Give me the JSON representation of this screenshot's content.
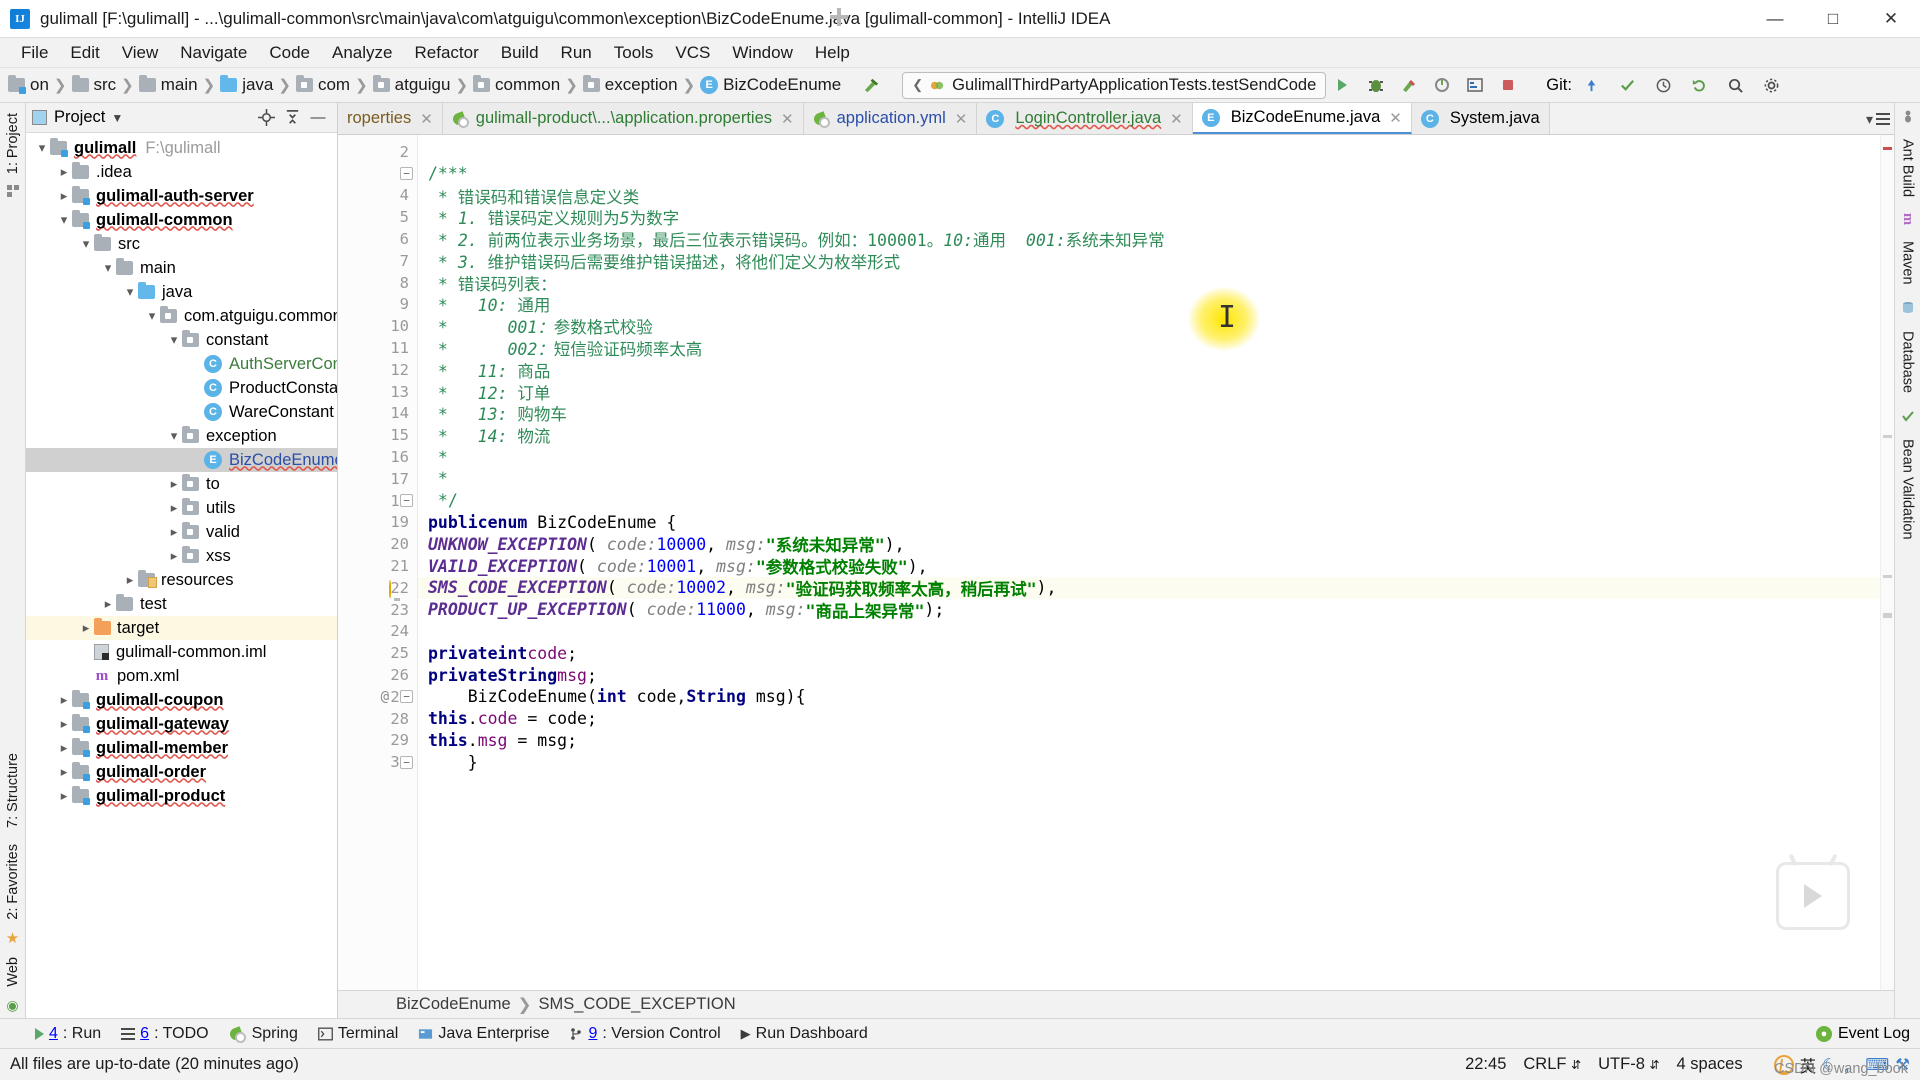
{
  "window": {
    "title": "gulimall [F:\\gulimall] - ...\\gulimall-common\\src\\main\\java\\com\\atguigu\\common\\exception\\BizCodeEnume.java [gulimall-common] - IntelliJ IDEA",
    "logo_text": "IJ",
    "minimize": "—",
    "maximize": "□",
    "close": "✕"
  },
  "menu": [
    {
      "label": "File"
    },
    {
      "label": "Edit"
    },
    {
      "label": "View"
    },
    {
      "label": "Navigate"
    },
    {
      "label": "Code"
    },
    {
      "label": "Analyze"
    },
    {
      "label": "Refactor"
    },
    {
      "label": "Build"
    },
    {
      "label": "Run"
    },
    {
      "label": "Tools"
    },
    {
      "label": "VCS"
    },
    {
      "label": "Window"
    },
    {
      "label": "Help"
    }
  ],
  "navbar": {
    "crumbs": [
      {
        "label": "on",
        "icon": "module-icon"
      },
      {
        "label": "src",
        "icon": "folder-icon"
      },
      {
        "label": "main",
        "icon": "folder-icon"
      },
      {
        "label": "java",
        "icon": "source-folder-icon"
      },
      {
        "label": "com",
        "icon": "package-icon"
      },
      {
        "label": "atguigu",
        "icon": "package-icon"
      },
      {
        "label": "common",
        "icon": "package-icon"
      },
      {
        "label": "exception",
        "icon": "package-icon"
      },
      {
        "label": "BizCodeEnume",
        "icon": "enum-icon"
      }
    ],
    "run_config": "GulimallThirdPartyApplicationTests.testSendCode",
    "git_label": "Git:"
  },
  "project_panel": {
    "title": "Project",
    "tree": [
      {
        "depth": 0,
        "twist": "v",
        "label": "gulimall",
        "hint": "F:\\gulimall",
        "icon": "module-icon",
        "style": "bold",
        "state": "normal"
      },
      {
        "depth": 1,
        "twist": ">",
        "label": ".idea",
        "icon": "folder-icon",
        "style": "muted",
        "state": "normal"
      },
      {
        "depth": 1,
        "twist": ">",
        "label": "gulimall-auth-server",
        "icon": "module-icon",
        "style": "bold",
        "state": "normal"
      },
      {
        "depth": 1,
        "twist": "v",
        "label": "gulimall-common",
        "icon": "module-icon",
        "style": "bold",
        "state": "normal"
      },
      {
        "depth": 2,
        "twist": "v",
        "label": "src",
        "icon": "folder-icon",
        "style": "normal",
        "state": "normal"
      },
      {
        "depth": 3,
        "twist": "v",
        "label": "main",
        "icon": "folder-icon",
        "style": "normal",
        "state": "normal"
      },
      {
        "depth": 4,
        "twist": "v",
        "label": "java",
        "icon": "source-folder-icon",
        "style": "normal",
        "state": "normal"
      },
      {
        "depth": 5,
        "twist": "v",
        "label": "com.atguigu.common",
        "icon": "package-icon",
        "style": "normal",
        "state": "normal"
      },
      {
        "depth": 6,
        "twist": "v",
        "label": "constant",
        "icon": "package-icon",
        "style": "normal",
        "state": "normal"
      },
      {
        "depth": 7,
        "twist": "",
        "label": "AuthServerConst",
        "icon": "class-icon",
        "style": "green",
        "state": "normal"
      },
      {
        "depth": 7,
        "twist": "",
        "label": "ProductConstant",
        "icon": "class-icon",
        "style": "normal",
        "state": "normal"
      },
      {
        "depth": 7,
        "twist": "",
        "label": "WareConstant",
        "icon": "class-icon",
        "style": "normal",
        "state": "normal"
      },
      {
        "depth": 6,
        "twist": "v",
        "label": "exception",
        "icon": "package-icon",
        "style": "normal",
        "state": "normal"
      },
      {
        "depth": 7,
        "twist": "",
        "label": "BizCodeEnume",
        "icon": "enum-icon",
        "style": "blue",
        "state": "selected"
      },
      {
        "depth": 6,
        "twist": ">",
        "label": "to",
        "icon": "package-icon",
        "style": "normal",
        "state": "normal"
      },
      {
        "depth": 6,
        "twist": ">",
        "label": "utils",
        "icon": "package-icon",
        "style": "normal",
        "state": "normal"
      },
      {
        "depth": 6,
        "twist": ">",
        "label": "valid",
        "icon": "package-icon",
        "style": "normal",
        "state": "normal"
      },
      {
        "depth": 6,
        "twist": ">",
        "label": "xss",
        "icon": "package-icon",
        "style": "normal",
        "state": "normal"
      },
      {
        "depth": 4,
        "twist": ">",
        "label": "resources",
        "icon": "resources-folder-icon",
        "style": "normal",
        "state": "normal"
      },
      {
        "depth": 3,
        "twist": ">",
        "label": "test",
        "icon": "folder-icon",
        "style": "normal",
        "state": "normal"
      },
      {
        "depth": 2,
        "twist": ">",
        "label": "target",
        "icon": "target-folder-icon",
        "style": "normal",
        "state": "highlight"
      },
      {
        "depth": 2,
        "twist": "",
        "label": "gulimall-common.iml",
        "icon": "iml-file-icon",
        "style": "normal",
        "state": "normal"
      },
      {
        "depth": 2,
        "twist": "",
        "label": "pom.xml",
        "icon": "maven-icon",
        "style": "normal",
        "state": "normal"
      },
      {
        "depth": 1,
        "twist": ">",
        "label": "gulimall-coupon",
        "icon": "module-icon",
        "style": "bold",
        "state": "normal"
      },
      {
        "depth": 1,
        "twist": ">",
        "label": "gulimall-gateway",
        "icon": "module-icon",
        "style": "bold",
        "state": "normal"
      },
      {
        "depth": 1,
        "twist": ">",
        "label": "gulimall-member",
        "icon": "module-icon",
        "style": "bold",
        "state": "normal"
      },
      {
        "depth": 1,
        "twist": ">",
        "label": "gulimall-order",
        "icon": "module-icon",
        "style": "bold",
        "state": "normal"
      },
      {
        "depth": 1,
        "twist": ">",
        "label": "gulimall-product",
        "icon": "module-icon",
        "style": "bold",
        "state": "normal"
      }
    ]
  },
  "left_rail": {
    "top": [
      "1: Project"
    ],
    "bottom": [
      "7: Structure",
      "2: Favorites",
      "Web"
    ]
  },
  "right_rail": [
    "Ant Build",
    "Maven",
    "Database",
    "Bean Validation"
  ],
  "editor_tabs": [
    {
      "label": "roperties",
      "icon": "properties-icon",
      "active": false,
      "color": "brown"
    },
    {
      "label": "gulimall-product\\...\\application.properties",
      "icon": "spring-icon",
      "active": false,
      "color": "green"
    },
    {
      "label": "application.yml",
      "icon": "spring-icon",
      "active": false,
      "color": "blue"
    },
    {
      "label": "LoginController.java",
      "icon": "class-icon",
      "active": false,
      "color": "green",
      "error": true
    },
    {
      "label": "BizCodeEnume.java",
      "icon": "enum-icon",
      "active": true,
      "color": "plain"
    },
    {
      "label": "System.java",
      "icon": "class-icon",
      "active": false,
      "color": "plain"
    }
  ],
  "editor": {
    "first_line": 2,
    "lines": [
      {
        "n": 2,
        "text": "",
        "fold": "",
        "mark": ""
      },
      {
        "n": 3,
        "text": "/***",
        "fold": "-",
        "mark": ""
      },
      {
        "n": 4,
        "text": " * 错误码和错误信息定义类",
        "fold": "",
        "mark": ""
      },
      {
        "n": 5,
        "text": " * 1. 错误码定义规则为5为数字",
        "fold": "",
        "mark": ""
      },
      {
        "n": 6,
        "text": " * 2. 前两位表示业务场景，最后三位表示错误码。例如：100001。10:通用  001:系统未知异常",
        "fold": "",
        "mark": ""
      },
      {
        "n": 7,
        "text": " * 3. 维护错误码后需要维护错误描述，将他们定义为枚举形式",
        "fold": "",
        "mark": ""
      },
      {
        "n": 8,
        "text": " * 错误码列表：",
        "fold": "",
        "mark": ""
      },
      {
        "n": 9,
        "text": " *   10: 通用",
        "fold": "",
        "mark": ""
      },
      {
        "n": 10,
        "text": " *      001：参数格式校验",
        "fold": "",
        "mark": ""
      },
      {
        "n": 11,
        "text": " *      002：短信验证码频率太高",
        "fold": "",
        "mark": ""
      },
      {
        "n": 12,
        "text": " *   11: 商品",
        "fold": "",
        "mark": ""
      },
      {
        "n": 13,
        "text": " *   12: 订单",
        "fold": "",
        "mark": ""
      },
      {
        "n": 14,
        "text": " *   13: 购物车",
        "fold": "",
        "mark": ""
      },
      {
        "n": 15,
        "text": " *   14: 物流",
        "fold": "",
        "mark": ""
      },
      {
        "n": 16,
        "text": " *",
        "fold": "",
        "mark": ""
      },
      {
        "n": 17,
        "text": " *",
        "fold": "",
        "mark": ""
      },
      {
        "n": 18,
        "text": " */",
        "fold": "-",
        "mark": ""
      },
      {
        "n": 19,
        "text": "public enum BizCodeEnume {",
        "fold": "",
        "mark": ""
      },
      {
        "n": 20,
        "text": "    UNKNOW_EXCEPTION( code: 10000, msg: \"系统未知异常\"),",
        "fold": "",
        "mark": ""
      },
      {
        "n": 21,
        "text": "    VAILD_EXCEPTION( code: 10001, msg: \"参数格式校验失败\"),",
        "fold": "",
        "mark": ""
      },
      {
        "n": 22,
        "text": "    SMS_CODE_EXCEPTION( code: 10002, msg: \"验证码获取频率太高，稍后再试\"),",
        "fold": "",
        "mark": "bulb"
      },
      {
        "n": 23,
        "text": "    PRODUCT_UP_EXCEPTION( code: 11000, msg: \"商品上架异常\");",
        "fold": "",
        "mark": ""
      },
      {
        "n": 24,
        "text": "",
        "fold": "",
        "mark": ""
      },
      {
        "n": 25,
        "text": "    private int code;",
        "fold": "",
        "mark": ""
      },
      {
        "n": 26,
        "text": "    private String msg;",
        "fold": "",
        "mark": ""
      },
      {
        "n": 27,
        "text": "    BizCodeEnume(int code,String msg){",
        "fold": "-",
        "mark": "@"
      },
      {
        "n": 28,
        "text": "        this.code = code;",
        "fold": "",
        "mark": ""
      },
      {
        "n": 29,
        "text": "        this.msg = msg;",
        "fold": "",
        "mark": ""
      },
      {
        "n": 30,
        "text": "    }",
        "fold": "-",
        "mark": ""
      }
    ],
    "breadcrumb": [
      "BizCodeEnume",
      "SMS_CODE_EXCEPTION"
    ]
  },
  "tool_windows": [
    {
      "num": "4",
      "label": ": Run",
      "icon": "run-icon"
    },
    {
      "num": "6",
      "label": ": TODO",
      "icon": "todo-icon"
    },
    {
      "num": "",
      "label": "Spring",
      "icon": "spring-icon"
    },
    {
      "num": "",
      "label": "Terminal",
      "icon": "terminal-icon"
    },
    {
      "num": "",
      "label": "Java Enterprise",
      "icon": "java-ee-icon"
    },
    {
      "num": "9",
      "label": ": Version Control",
      "icon": "vcs-icon"
    },
    {
      "num": "",
      "label": "Run Dashboard",
      "icon": "dashboard-icon"
    }
  ],
  "event_log": "Event Log",
  "status_bar": {
    "message": "All files are up-to-date (20 minutes ago)",
    "position": "22:45",
    "line_sep": "CRLF",
    "encoding": "UTF-8",
    "indent": "4 spaces",
    "ime": "英",
    "watermark": "CSDN @wang_book"
  }
}
